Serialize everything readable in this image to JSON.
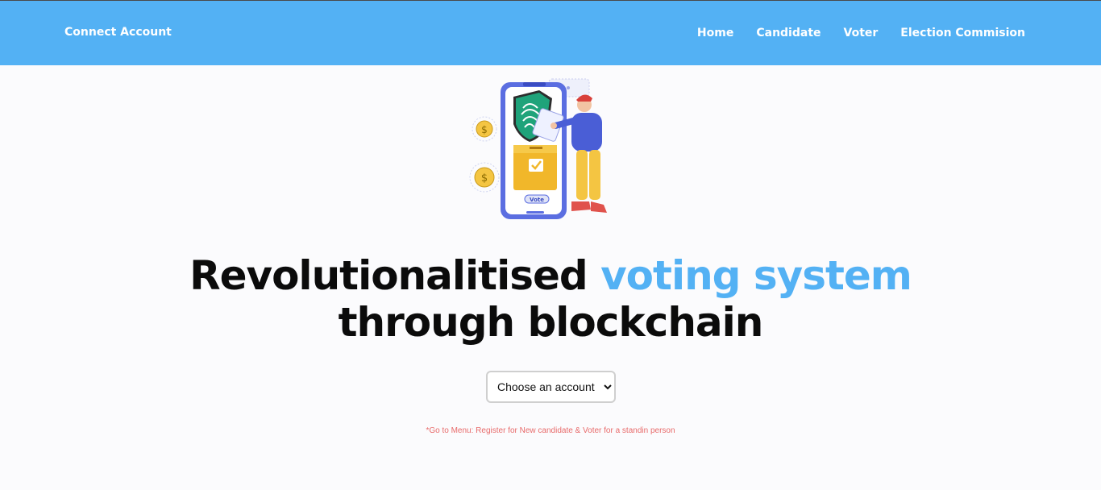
{
  "header": {
    "brand": "Connect Account",
    "nav": [
      "Home",
      "Candidate",
      "Voter",
      "Election Commision"
    ]
  },
  "hero": {
    "title_part1": "Revolutionalitised ",
    "title_accent": "voting system",
    "title_line2": "through blockchain",
    "illustration_label": "Vote"
  },
  "account_select": {
    "selected": "Choose an account",
    "options": [
      "Choose an account"
    ]
  },
  "hint": "*Go to Menu: Register for New candidate & Voter for a standin person",
  "colors": {
    "header_bg": "#53b1f4",
    "accent": "#53b1f4",
    "hint": "#e86a6a",
    "page_bg": "#fbfbfd"
  },
  "icons": [
    "phone-icon",
    "shield-fingerprint-icon",
    "ballot-box-icon",
    "coin-icon",
    "person-icon"
  ]
}
